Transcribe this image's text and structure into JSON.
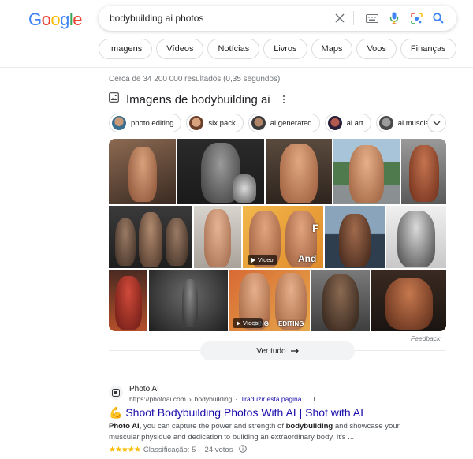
{
  "logo": {
    "letters": [
      "G",
      "o",
      "o",
      "g",
      "l",
      "e"
    ],
    "colors": [
      "#4285f4",
      "#ea4335",
      "#fbbc05",
      "#4285f4",
      "#34a853",
      "#ea4335"
    ]
  },
  "search": {
    "query": "bodybuilding ai photos"
  },
  "tabs": [
    "Imagens",
    "Vídeos",
    "Notícias",
    "Livros",
    "Maps",
    "Voos",
    "Finanças"
  ],
  "stats": "Cerca de 34 200 000 resultados (0,35 segundos)",
  "images": {
    "title": "Imagens de bodybuilding ai",
    "filters": [
      "photo editing",
      "six pack",
      "ai generated",
      "ai art",
      "ai muscle"
    ],
    "video_label": "Vídeo",
    "captions": {
      "and": "And",
      "f": "F",
      "ding": "DING",
      "editing": "EDITING"
    },
    "feedback": "Feedback",
    "see_all": "Ver tudo"
  },
  "result": {
    "site_name": "Photo AI",
    "url": "https://photoai.com",
    "breadcrumb": "bodybuilding",
    "translate": "Traduzir esta página",
    "emoji": "💪",
    "title": "Shoot Bodybuilding Photos With AI | Shot with AI",
    "snippet_parts": [
      "Photo AI",
      ", you can capture the power and strength of ",
      "bodybuilding",
      " and showcase your muscular physique and dedication to building an extraordinary body. It's ..."
    ],
    "stars": "★★★★★",
    "rating_label": "Classificação: 5",
    "votes": "24 votos"
  },
  "colors": {
    "link": "#1a0dab",
    "star": "#fbbc04",
    "muted": "#70757a"
  }
}
